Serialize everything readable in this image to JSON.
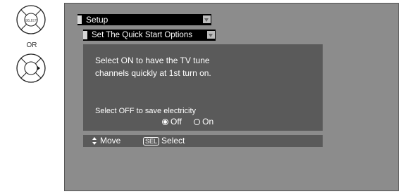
{
  "remote": {
    "select_button_label": "SELECT",
    "or_label": "OR",
    "right_button_icon": "play-right-icon"
  },
  "menu": {
    "title": "Setup",
    "submenu_title": "Set The Quick Start Options"
  },
  "panel": {
    "line1": "Select ON to have the TV tune",
    "line2": "channels quickly at 1st turn on.",
    "line3": "Select OFF to save electricity",
    "options": [
      {
        "label": "Off",
        "selected": true
      },
      {
        "label": "On",
        "selected": false
      }
    ]
  },
  "help": {
    "move_label": "Move",
    "sel_badge": "SEL",
    "select_label": "Select"
  },
  "colors": {
    "screen_bg": "#8c8c8c",
    "panel_bg": "#5a5a5a",
    "menu_bar_bg": "#000000"
  }
}
